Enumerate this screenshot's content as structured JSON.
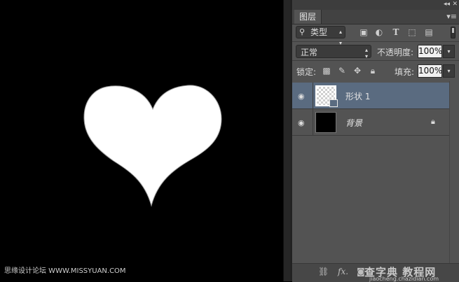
{
  "canvas": {
    "background": "#000000",
    "shape_fill": "#ffffff",
    "watermark": "思缘设计论坛 WWW.MISSYUAN.COM"
  },
  "panel": {
    "tab_label": "图层",
    "collapse_icon": "double-chevron-left-icon",
    "menu_icon": "panel-menu-icon",
    "filter": {
      "selected": "类型",
      "icons": [
        "image-filter-icon",
        "adjustment-filter-icon",
        "type-filter-icon",
        "shape-filter-icon",
        "smart-object-filter-icon"
      ]
    },
    "blend_mode": "正常",
    "opacity_label": "不透明度:",
    "opacity_value": "100%",
    "lock_label": "锁定:",
    "lock_icons": [
      "lock-transparent-icon",
      "lock-paint-icon",
      "lock-position-icon",
      "lock-all-icon"
    ],
    "fill_label": "填充:",
    "fill_value": "100%",
    "layers": [
      {
        "name": "形状 1",
        "selected": true,
        "thumb": "shape-thumbnail",
        "visible": true
      },
      {
        "name": "背景",
        "selected": false,
        "thumb": "background-thumbnail",
        "visible": true,
        "locked": true
      }
    ],
    "bottom_icons": [
      "link-icon",
      "fx-icon",
      "mask-icon"
    ],
    "watermark_right": "查字典 教程网",
    "watermark_right_url": "jiaocheng.chazidian.com"
  },
  "colors": {
    "panel_bg": "#535353",
    "selected_row": "#5a6b80",
    "dark_bar": "#424242"
  }
}
